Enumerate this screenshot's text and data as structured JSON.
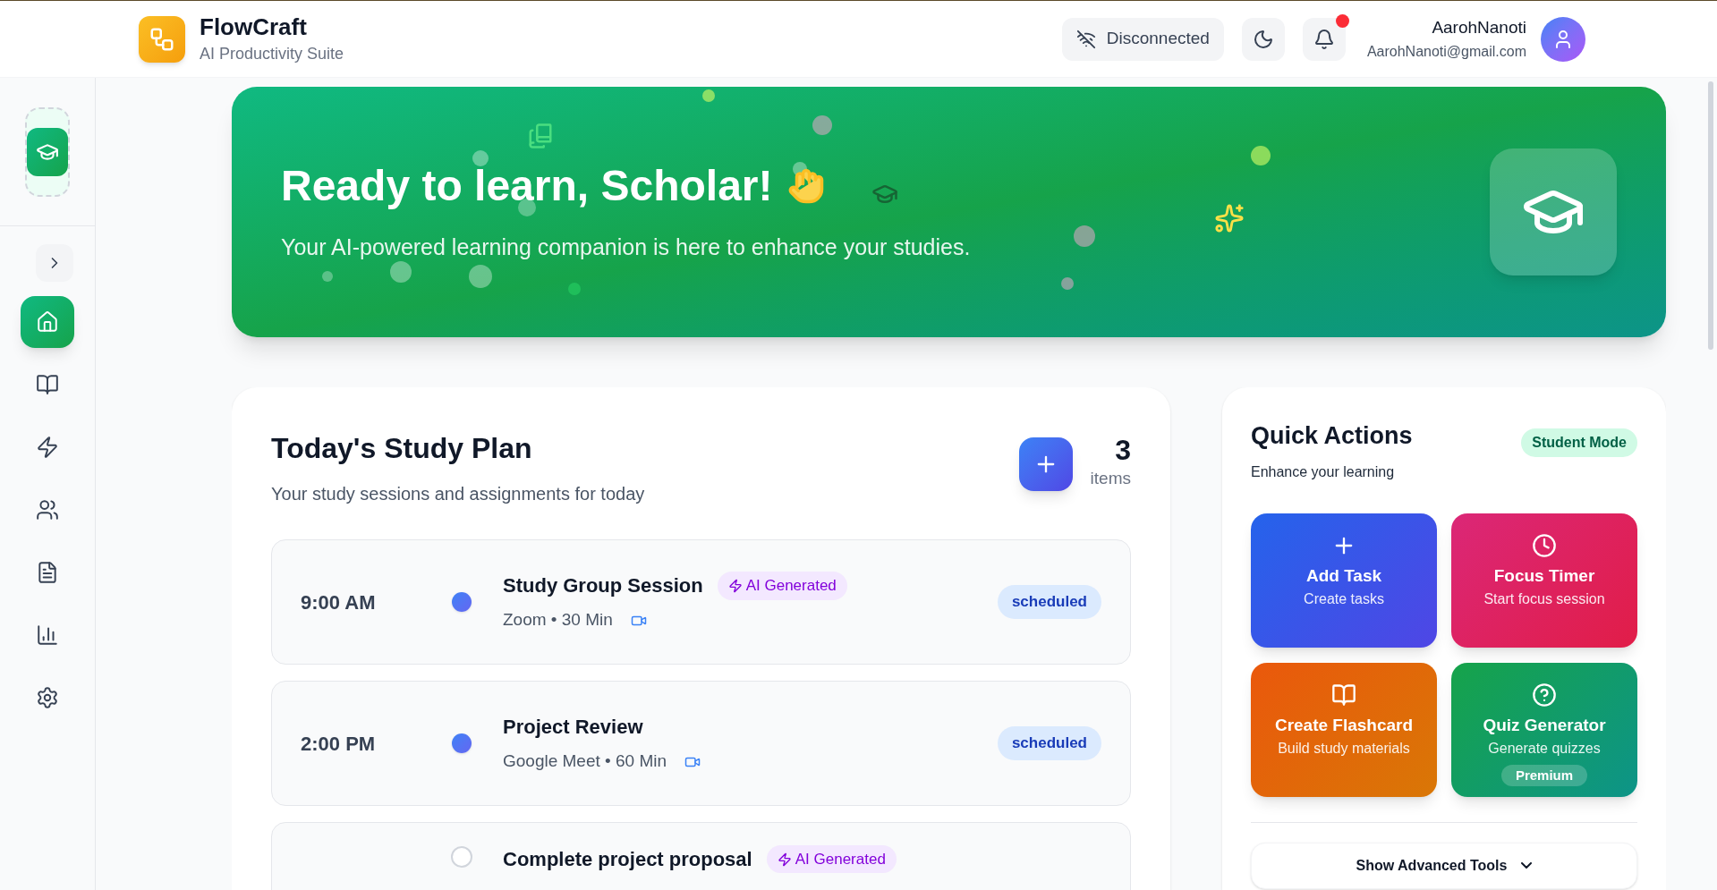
{
  "header": {
    "app_name": "FlowCraft",
    "tagline": "AI Productivity Suite",
    "connection": "Disconnected",
    "notifications_unread": true,
    "user": {
      "name": "AarohNanoti",
      "email": "AarohNanoti@gmail.com"
    }
  },
  "sidebar": {
    "items": [
      {
        "kind": "home",
        "selected": true
      },
      {
        "kind": "book",
        "selected": false
      },
      {
        "kind": "zap",
        "selected": false
      },
      {
        "kind": "users",
        "selected": false
      },
      {
        "kind": "file",
        "selected": false
      },
      {
        "kind": "chart",
        "selected": false
      },
      {
        "kind": "settings",
        "selected": false
      }
    ]
  },
  "banner": {
    "title": "Ready to learn, Scholar!",
    "subtitle": "Your AI-powered learning companion is here to enhance your studies."
  },
  "study_plan": {
    "title": "Today's Study Plan",
    "subtitle": "Your study sessions and assignments for today",
    "count": "3",
    "count_label": "items",
    "items": [
      {
        "kind": "session",
        "time": "9:00 AM",
        "title": "Study Group Session",
        "ai_badge": "AI Generated",
        "platform": "Zoom",
        "separator": "•",
        "duration": "30 Min",
        "status": "scheduled"
      },
      {
        "kind": "session",
        "time": "2:00 PM",
        "title": "Project Review",
        "platform": "Google Meet",
        "separator": "•",
        "duration": "60 Min",
        "status": "scheduled"
      },
      {
        "kind": "task",
        "title": "Complete project proposal",
        "ai_badge": "AI Generated",
        "checked": false
      }
    ]
  },
  "quick_actions": {
    "title": "Quick Actions",
    "subtitle": "Enhance your learning",
    "mode": "Student Mode",
    "tiles": [
      {
        "title": "Add Task",
        "description": "Create tasks",
        "color": "#2563eb"
      },
      {
        "title": "Focus Timer",
        "description": "Start focus session",
        "color": "#db2777"
      },
      {
        "title": "Create Flashcard",
        "description": "Build study materials",
        "color": "#ea580c"
      },
      {
        "title": "Quiz Generator",
        "description": "Generate quizzes",
        "badge": "Premium",
        "color": "#16a34a"
      }
    ],
    "advanced_toggle": "Show Advanced Tools"
  }
}
